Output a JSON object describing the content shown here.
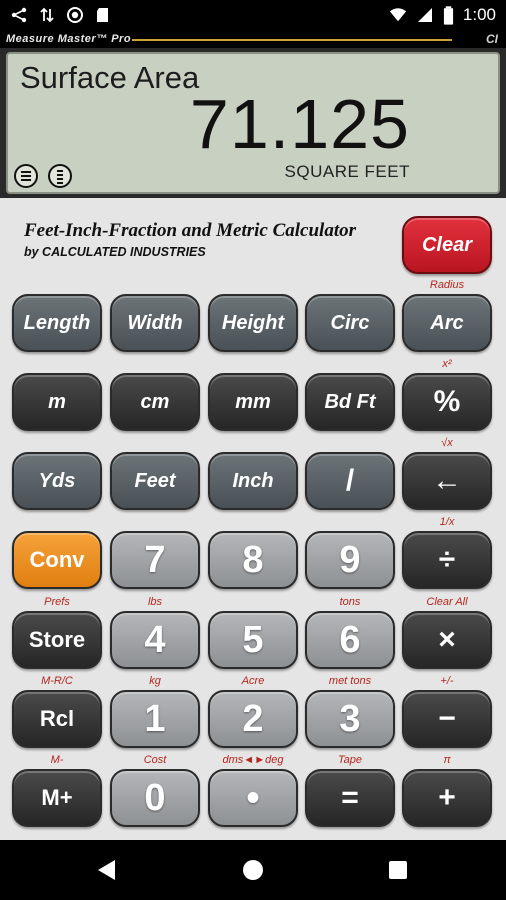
{
  "status_bar": {
    "time": "1:00",
    "icons": [
      "bluetooth-icon",
      "data-transfer-icon",
      "sync-icon",
      "sd-card-icon",
      "wifi-icon",
      "signal-icon",
      "battery-icon"
    ]
  },
  "header": {
    "brand": "Measure Master™ Pro",
    "logo": "CI",
    "accent_line_color": "#c9a233"
  },
  "display": {
    "label": "Surface Area",
    "value": "71.125",
    "unit": "SQUARE FEET",
    "icons": [
      "menu-icon",
      "tape-icon"
    ]
  },
  "calculator": {
    "title_line1": "Feet-Inch-Fraction and Metric Calculator",
    "title_line2": "by CALCULATED INDUSTRIES",
    "clear_label": "Clear",
    "rows": [
      {
        "keys": [
          "Length",
          "Width",
          "Height",
          "Circ",
          "Arc"
        ],
        "subs": [
          "",
          "",
          "",
          "",
          "Radius"
        ]
      },
      {
        "keys": [
          "m",
          "cm",
          "mm",
          "Bd Ft",
          "%"
        ],
        "subs": [
          "",
          "",
          "",
          "",
          "x²"
        ]
      },
      {
        "keys": [
          "Yds",
          "Feet",
          "Inch",
          "/",
          "←"
        ],
        "subs": [
          "",
          "",
          "",
          "",
          "√x"
        ]
      },
      {
        "keys": [
          "Conv",
          "7",
          "8",
          "9",
          "÷"
        ],
        "subs": [
          "",
          "",
          "",
          "",
          "1/x"
        ]
      },
      {
        "keys": [
          "Store",
          "4",
          "5",
          "6",
          "×"
        ],
        "subs": [
          "Prefs",
          "lbs",
          "",
          "tons",
          "Clear All"
        ]
      },
      {
        "keys": [
          "Rcl",
          "1",
          "2",
          "3",
          "−"
        ],
        "subs": [
          "M-R/C",
          "kg",
          "Acre",
          "met tons",
          "+/-"
        ]
      },
      {
        "keys": [
          "M+",
          "0",
          "•",
          "=",
          "+"
        ],
        "subs": [
          "M-",
          "Cost",
          "dms◄►deg",
          "Tape",
          "π"
        ]
      }
    ]
  },
  "colors": {
    "lcd_background": "#c8d0c2",
    "clear_key": "#d62632",
    "conv_key": "#ef9420",
    "sub_label": "#b5261e",
    "body_background": "#e5e5e5"
  },
  "nav_bar": {
    "icons": [
      "back-icon",
      "home-icon",
      "recents-icon"
    ]
  }
}
